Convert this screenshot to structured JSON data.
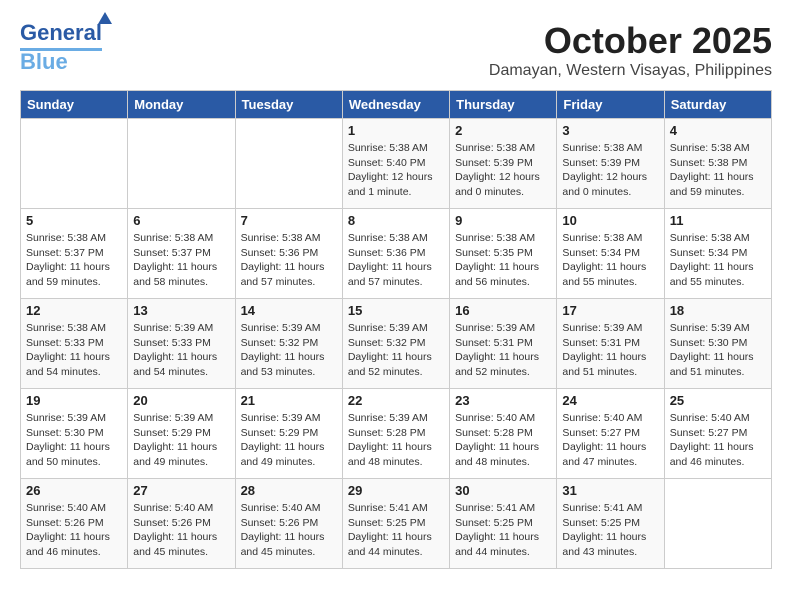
{
  "logo": {
    "line1": "General",
    "line2": "Blue"
  },
  "title": "October 2025",
  "subtitle": "Damayan, Western Visayas, Philippines",
  "days_of_week": [
    "Sunday",
    "Monday",
    "Tuesday",
    "Wednesday",
    "Thursday",
    "Friday",
    "Saturday"
  ],
  "weeks": [
    [
      {
        "day": "",
        "info": ""
      },
      {
        "day": "",
        "info": ""
      },
      {
        "day": "",
        "info": ""
      },
      {
        "day": "1",
        "info": "Sunrise: 5:38 AM\nSunset: 5:40 PM\nDaylight: 12 hours\nand 1 minute."
      },
      {
        "day": "2",
        "info": "Sunrise: 5:38 AM\nSunset: 5:39 PM\nDaylight: 12 hours\nand 0 minutes."
      },
      {
        "day": "3",
        "info": "Sunrise: 5:38 AM\nSunset: 5:39 PM\nDaylight: 12 hours\nand 0 minutes."
      },
      {
        "day": "4",
        "info": "Sunrise: 5:38 AM\nSunset: 5:38 PM\nDaylight: 11 hours\nand 59 minutes."
      }
    ],
    [
      {
        "day": "5",
        "info": "Sunrise: 5:38 AM\nSunset: 5:37 PM\nDaylight: 11 hours\nand 59 minutes."
      },
      {
        "day": "6",
        "info": "Sunrise: 5:38 AM\nSunset: 5:37 PM\nDaylight: 11 hours\nand 58 minutes."
      },
      {
        "day": "7",
        "info": "Sunrise: 5:38 AM\nSunset: 5:36 PM\nDaylight: 11 hours\nand 57 minutes."
      },
      {
        "day": "8",
        "info": "Sunrise: 5:38 AM\nSunset: 5:36 PM\nDaylight: 11 hours\nand 57 minutes."
      },
      {
        "day": "9",
        "info": "Sunrise: 5:38 AM\nSunset: 5:35 PM\nDaylight: 11 hours\nand 56 minutes."
      },
      {
        "day": "10",
        "info": "Sunrise: 5:38 AM\nSunset: 5:34 PM\nDaylight: 11 hours\nand 55 minutes."
      },
      {
        "day": "11",
        "info": "Sunrise: 5:38 AM\nSunset: 5:34 PM\nDaylight: 11 hours\nand 55 minutes."
      }
    ],
    [
      {
        "day": "12",
        "info": "Sunrise: 5:38 AM\nSunset: 5:33 PM\nDaylight: 11 hours\nand 54 minutes."
      },
      {
        "day": "13",
        "info": "Sunrise: 5:39 AM\nSunset: 5:33 PM\nDaylight: 11 hours\nand 54 minutes."
      },
      {
        "day": "14",
        "info": "Sunrise: 5:39 AM\nSunset: 5:32 PM\nDaylight: 11 hours\nand 53 minutes."
      },
      {
        "day": "15",
        "info": "Sunrise: 5:39 AM\nSunset: 5:32 PM\nDaylight: 11 hours\nand 52 minutes."
      },
      {
        "day": "16",
        "info": "Sunrise: 5:39 AM\nSunset: 5:31 PM\nDaylight: 11 hours\nand 52 minutes."
      },
      {
        "day": "17",
        "info": "Sunrise: 5:39 AM\nSunset: 5:31 PM\nDaylight: 11 hours\nand 51 minutes."
      },
      {
        "day": "18",
        "info": "Sunrise: 5:39 AM\nSunset: 5:30 PM\nDaylight: 11 hours\nand 51 minutes."
      }
    ],
    [
      {
        "day": "19",
        "info": "Sunrise: 5:39 AM\nSunset: 5:30 PM\nDaylight: 11 hours\nand 50 minutes."
      },
      {
        "day": "20",
        "info": "Sunrise: 5:39 AM\nSunset: 5:29 PM\nDaylight: 11 hours\nand 49 minutes."
      },
      {
        "day": "21",
        "info": "Sunrise: 5:39 AM\nSunset: 5:29 PM\nDaylight: 11 hours\nand 49 minutes."
      },
      {
        "day": "22",
        "info": "Sunrise: 5:39 AM\nSunset: 5:28 PM\nDaylight: 11 hours\nand 48 minutes."
      },
      {
        "day": "23",
        "info": "Sunrise: 5:40 AM\nSunset: 5:28 PM\nDaylight: 11 hours\nand 48 minutes."
      },
      {
        "day": "24",
        "info": "Sunrise: 5:40 AM\nSunset: 5:27 PM\nDaylight: 11 hours\nand 47 minutes."
      },
      {
        "day": "25",
        "info": "Sunrise: 5:40 AM\nSunset: 5:27 PM\nDaylight: 11 hours\nand 46 minutes."
      }
    ],
    [
      {
        "day": "26",
        "info": "Sunrise: 5:40 AM\nSunset: 5:26 PM\nDaylight: 11 hours\nand 46 minutes."
      },
      {
        "day": "27",
        "info": "Sunrise: 5:40 AM\nSunset: 5:26 PM\nDaylight: 11 hours\nand 45 minutes."
      },
      {
        "day": "28",
        "info": "Sunrise: 5:40 AM\nSunset: 5:26 PM\nDaylight: 11 hours\nand 45 minutes."
      },
      {
        "day": "29",
        "info": "Sunrise: 5:41 AM\nSunset: 5:25 PM\nDaylight: 11 hours\nand 44 minutes."
      },
      {
        "day": "30",
        "info": "Sunrise: 5:41 AM\nSunset: 5:25 PM\nDaylight: 11 hours\nand 44 minutes."
      },
      {
        "day": "31",
        "info": "Sunrise: 5:41 AM\nSunset: 5:25 PM\nDaylight: 11 hours\nand 43 minutes."
      },
      {
        "day": "",
        "info": ""
      }
    ]
  ]
}
